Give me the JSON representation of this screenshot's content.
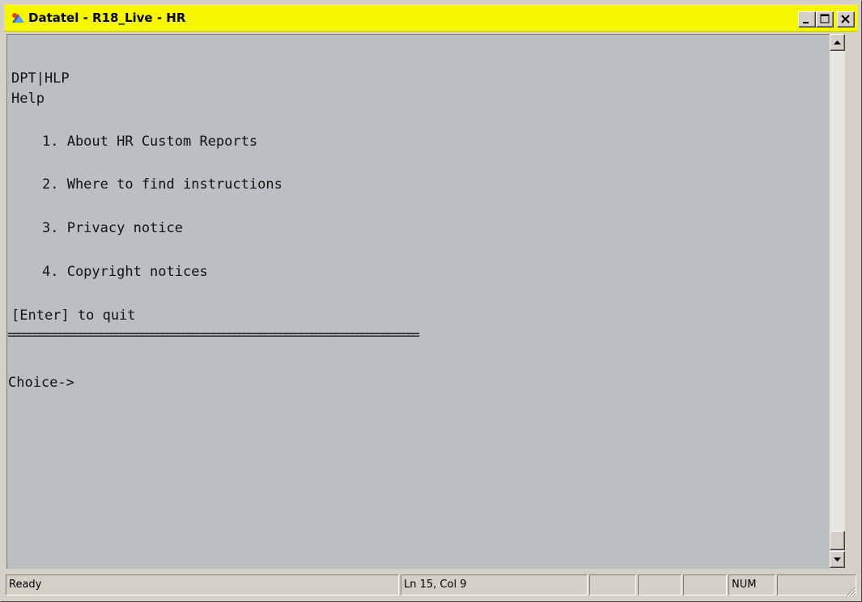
{
  "window": {
    "title": "Datatel - R18_Live - HR",
    "title_bar_color": "#f7f700",
    "app_icon": "datatel-app-icon",
    "controls": [
      "minimize-icon",
      "maximize-icon",
      "close-icon"
    ]
  },
  "terminal": {
    "background": "#babfc2",
    "screen_code": "DPT|HLP",
    "screen_title": "Help",
    "menu_items": [
      "1. About HR Custom Reports",
      "2. Where to find instructions",
      "3. Privacy notice",
      "4. Copyright notices"
    ],
    "quit_hint": "[Enter] to quit",
    "separator": "================================================================================",
    "prompt": "Choice->"
  },
  "status_bar": {
    "status": "Ready",
    "position": "Ln 15, Col 9",
    "num_lock": "NUM"
  }
}
